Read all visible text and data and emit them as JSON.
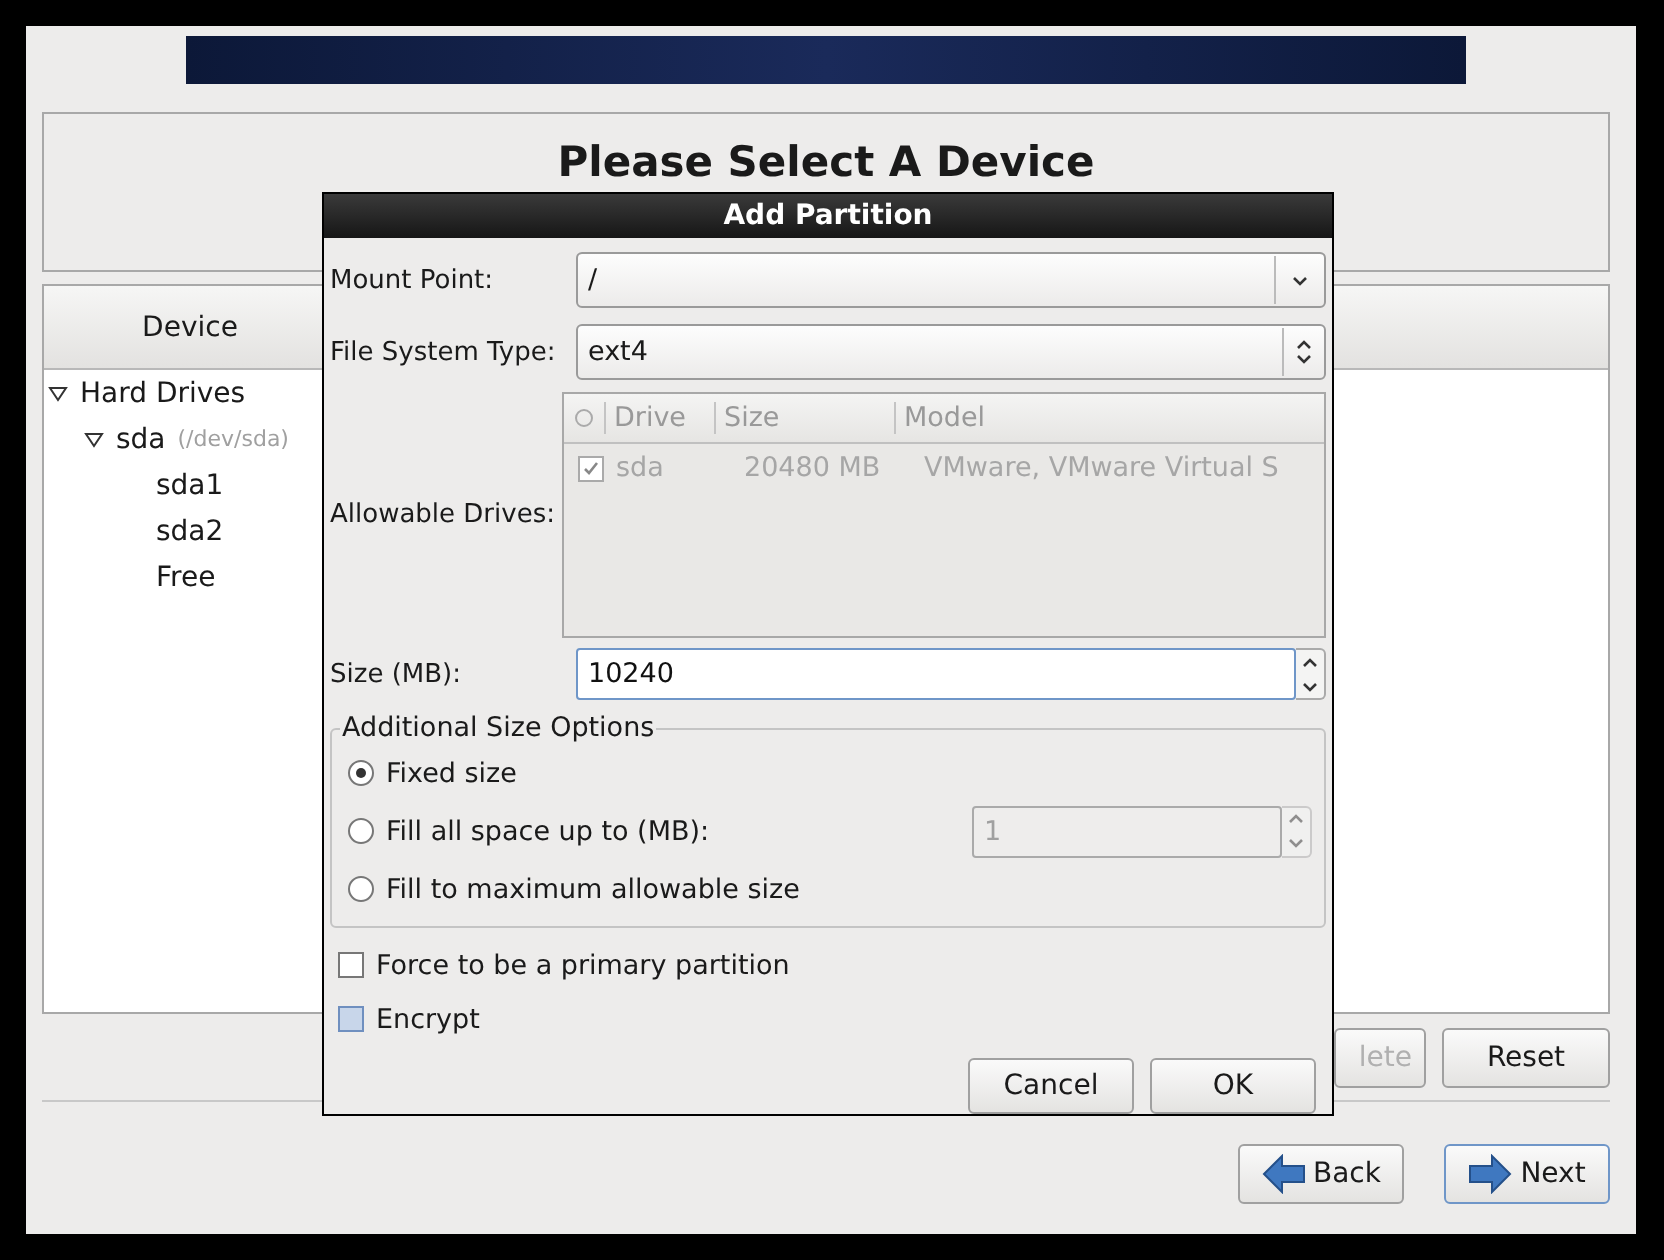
{
  "title": "Please Select A Device",
  "device_panel": {
    "column_header": "Device",
    "tree": [
      {
        "label": "Hard Drives",
        "expanded": true,
        "children": [
          {
            "label": "sda",
            "detail": "(/dev/sda)",
            "expanded": true,
            "children": [
              {
                "label": "sda1"
              },
              {
                "label": "sda2"
              },
              {
                "label": "Free"
              }
            ]
          }
        ]
      }
    ]
  },
  "panel_buttons": [
    {
      "label": "lete",
      "disabled": true
    },
    {
      "label": "Reset",
      "disabled": false
    }
  ],
  "nav_buttons": [
    {
      "label": "Back",
      "kind": "back",
      "focused": false
    },
    {
      "label": "Next",
      "kind": "next",
      "focused": true
    }
  ],
  "dialog": {
    "title": "Add Partition",
    "mount_point": {
      "label": "Mount Point:",
      "value": "/"
    },
    "file_system_type": {
      "label": "File System Type:",
      "value": "ext4"
    },
    "allowable_drives": {
      "label": "Allowable Drives:",
      "disabled": true,
      "columns": [
        "Drive",
        "Size",
        "Model"
      ],
      "rows": [
        {
          "checked": true,
          "cells": [
            "sda",
            "20480 MB",
            "VMware, VMware Virtual S"
          ]
        }
      ]
    },
    "size": {
      "label": "Size (MB):",
      "value": "10240"
    },
    "size_options": {
      "title": "Additional Size Options",
      "fill_value": "1",
      "options": [
        {
          "label": "Fixed size",
          "selected": true
        },
        {
          "label": "Fill all space up to (MB):",
          "selected": false
        },
        {
          "label": "Fill to maximum allowable size",
          "selected": false
        }
      ]
    },
    "checkboxes": [
      {
        "label": "Force to be a primary partition",
        "checked": false,
        "highlighted": false
      },
      {
        "label": "Encrypt",
        "checked": false,
        "highlighted": true
      }
    ],
    "buttons": [
      "Cancel",
      "OK"
    ]
  }
}
